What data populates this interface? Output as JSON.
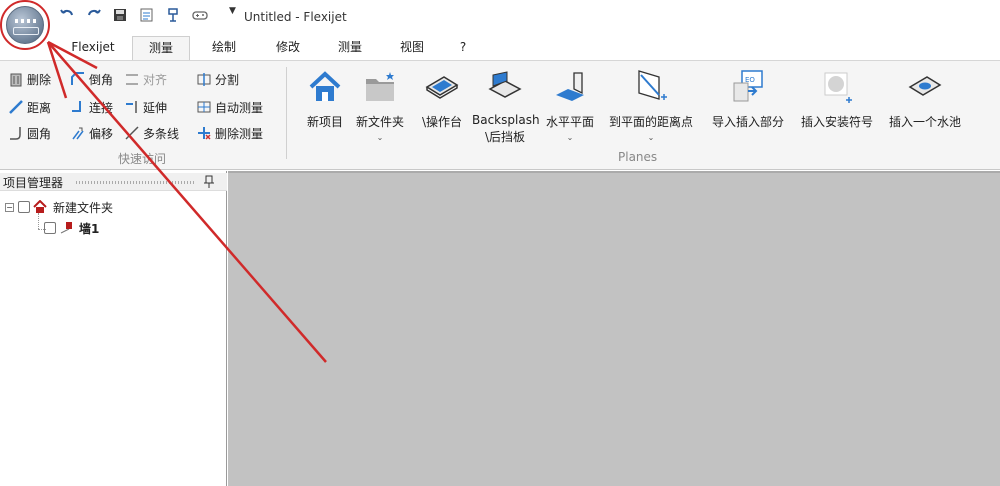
{
  "window": {
    "title": "Untitled - Flexijet"
  },
  "quick_access": {
    "icons": [
      "undo-icon",
      "redo-icon",
      "save-icon",
      "import-icon",
      "device-icon",
      "gamepad-icon"
    ],
    "dropdown": "▼"
  },
  "tabs": [
    {
      "label": "Flexijet",
      "active": false
    },
    {
      "label": "测量",
      "active": true
    },
    {
      "label": "绘制",
      "active": false
    },
    {
      "label": "修改",
      "active": false
    },
    {
      "label": "测量",
      "active": false
    },
    {
      "label": "视图",
      "active": false
    },
    {
      "label": "?",
      "active": false
    }
  ],
  "quick_group": {
    "label": "快速访问",
    "items": [
      {
        "label": "删除",
        "icon": "delete-icon",
        "enabled": true
      },
      {
        "label": "倒角",
        "icon": "chamfer-icon",
        "enabled": true
      },
      {
        "label": "对齐",
        "icon": "align-icon",
        "enabled": false
      },
      {
        "label": "分割",
        "icon": "split-icon",
        "enabled": true
      },
      {
        "label": "距离",
        "icon": "distance-icon",
        "enabled": true
      },
      {
        "label": "连接",
        "icon": "connect-icon",
        "enabled": true
      },
      {
        "label": "延伸",
        "icon": "extend-icon",
        "enabled": true
      },
      {
        "label": "自动测量",
        "icon": "auto-measure-icon",
        "enabled": true
      },
      {
        "label": "圆角",
        "icon": "fillet-icon",
        "enabled": true
      },
      {
        "label": "偏移",
        "icon": "offset-icon",
        "enabled": true
      },
      {
        "label": "多条线",
        "icon": "polyline-icon",
        "enabled": true
      },
      {
        "label": "删除测量",
        "icon": "delete-measure-icon",
        "enabled": true
      }
    ]
  },
  "planes_group": {
    "label": "Planes",
    "buttons": [
      {
        "label": "新项目",
        "label2": "",
        "icon": "home-icon",
        "dropdown": false
      },
      {
        "label": "新文件夹",
        "label2": "",
        "icon": "new-folder-icon",
        "dropdown": true
      },
      {
        "label": "\\操作台",
        "label2": "",
        "icon": "worktop-icon",
        "dropdown": false
      },
      {
        "label": "Backsplash",
        "label2": "\\后挡板",
        "icon": "backsplash-icon",
        "dropdown": false
      },
      {
        "label": "水平平面",
        "label2": "",
        "icon": "horizontal-plane-icon",
        "dropdown": true
      },
      {
        "label": "到平面的距离点",
        "label2": "",
        "icon": "distance-to-plane-icon",
        "dropdown": true
      },
      {
        "label": "导入插入部分",
        "label2": "",
        "icon": "import-insert-icon",
        "dropdown": false
      },
      {
        "label": "插入安装符号",
        "label2": "",
        "icon": "install-symbol-icon",
        "dropdown": false
      },
      {
        "label": "插入一个水池",
        "label2": "",
        "icon": "sink-icon",
        "dropdown": false
      }
    ]
  },
  "project_manager": {
    "title": "项目管理器",
    "tree": [
      {
        "label": "新建文件夹",
        "icon": "folder-home-icon",
        "expander": "−"
      },
      {
        "label": "墙1",
        "icon": "wall-flag-icon"
      }
    ]
  },
  "colors": {
    "annotation": "#d02a2a",
    "workspace": "#c2c2c2",
    "accent_blue": "#2e7bcf"
  }
}
